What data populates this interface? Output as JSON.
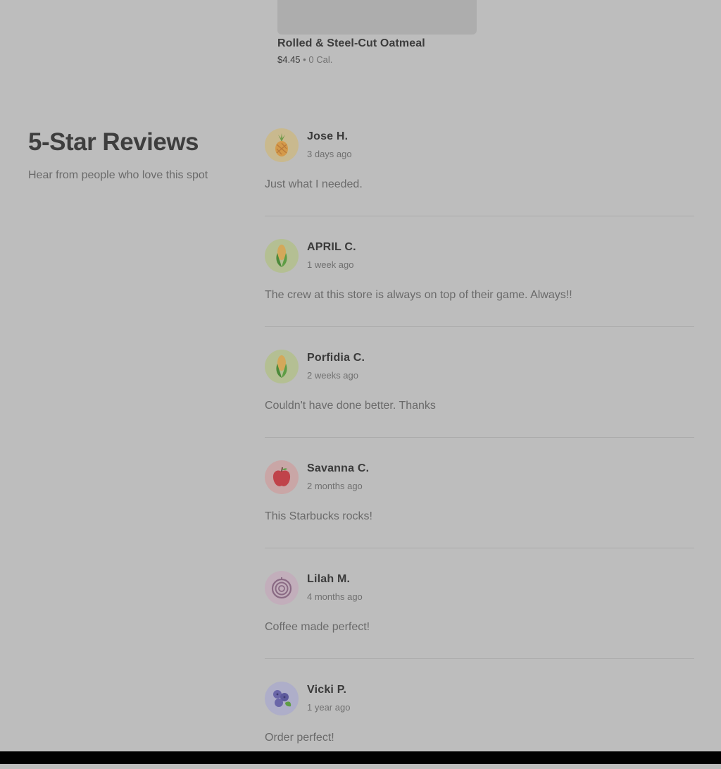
{
  "product": {
    "name": "Rolled & Steel-Cut Oatmeal",
    "price": "$4.45",
    "separator": "•",
    "calories": "0 Cal."
  },
  "reviews_section": {
    "title": "5-Star Reviews",
    "subtitle": "Hear from people who love this spot"
  },
  "reviews": [
    {
      "name": "Jose H.",
      "time": "3 days ago",
      "text": "Just what I needed.",
      "avatar_icon": "pineapple-icon",
      "avatar_bg": "#c9b98e"
    },
    {
      "name": "APRIL C.",
      "time": "1 week ago",
      "text": "The crew at this store is always on top of their game. Always!!",
      "avatar_icon": "corn-icon",
      "avatar_bg": "#b4bf93"
    },
    {
      "name": "Porfidia C.",
      "time": "2 weeks ago",
      "text": "Couldn't have done better. Thanks",
      "avatar_icon": "corn-icon",
      "avatar_bg": "#b4bf93"
    },
    {
      "name": "Savanna C.",
      "time": "2 months ago",
      "text": "This Starbucks rocks!",
      "avatar_icon": "apple-icon",
      "avatar_bg": "#c9a6a6"
    },
    {
      "name": "Lilah M.",
      "time": "4 months ago",
      "text": "Coffee made perfect!",
      "avatar_icon": "onion-icon",
      "avatar_bg": "#c2aebb"
    },
    {
      "name": "Vicki P.",
      "time": "1 year ago",
      "text": "Order perfect!",
      "avatar_icon": "blueberry-icon",
      "avatar_bg": "#aeaec9"
    }
  ]
}
